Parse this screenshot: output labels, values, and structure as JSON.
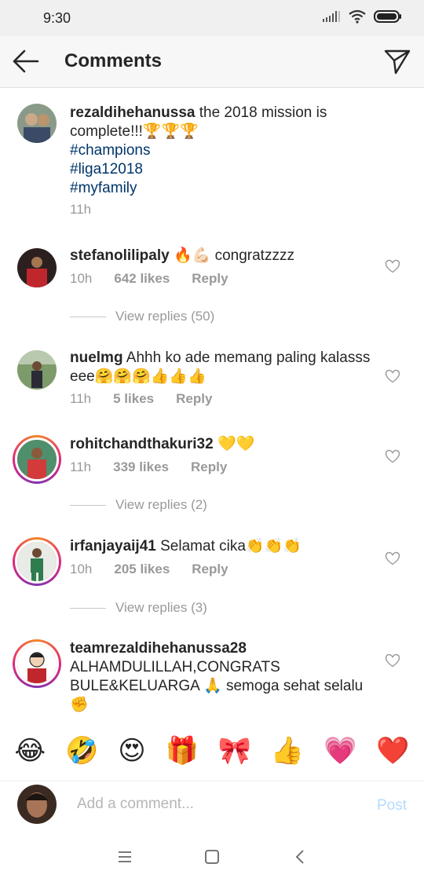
{
  "status_bar": {
    "time": "9:30"
  },
  "header": {
    "title": "Comments"
  },
  "caption": {
    "username": "rezaldihehanussa",
    "text": "the 2018 mission is complete!!!🏆🏆🏆",
    "hashtags": [
      "#champions",
      "#liga12018",
      "#myfamily"
    ],
    "time": "11h"
  },
  "comments": [
    {
      "username": "stefanolilipaly",
      "text": "🔥💪🏻 congratzzzz",
      "time": "10h",
      "likes": "642 likes",
      "reply": "Reply",
      "view_replies": "View replies (50)"
    },
    {
      "username": "nuelmg",
      "text": "Ahhh ko ade memang paling kalasss eee🤗🤗🤗👍👍👍",
      "time": "11h",
      "likes": "5 likes",
      "reply": "Reply"
    },
    {
      "username": "rohitchandthakuri32",
      "text": "💛💛",
      "time": "11h",
      "likes": "339 likes",
      "reply": "Reply",
      "view_replies": "View replies (2)"
    },
    {
      "username": "irfanjayaij41",
      "text": "Selamat cika👏👏👏",
      "time": "10h",
      "likes": "205 likes",
      "reply": "Reply",
      "view_replies": "View replies (3)"
    },
    {
      "username": "teamrezaldihehanussa28",
      "text": "ALHAMDULILLAH,CONGRATS BULE&KELUARGA 🙏 semoga sehat selalu ✊"
    }
  ],
  "emoji_bar": [
    "😂",
    "🤣",
    "😍",
    "🎁",
    "🎀",
    "👍",
    "💗",
    "❤️"
  ],
  "composer": {
    "placeholder": "Add a comment...",
    "post_label": "Post"
  },
  "colors": {
    "hashtag": "#003569",
    "muted": "#999999",
    "post_disabled": "#b3dbff",
    "story_ring": "#dd2a7b"
  }
}
